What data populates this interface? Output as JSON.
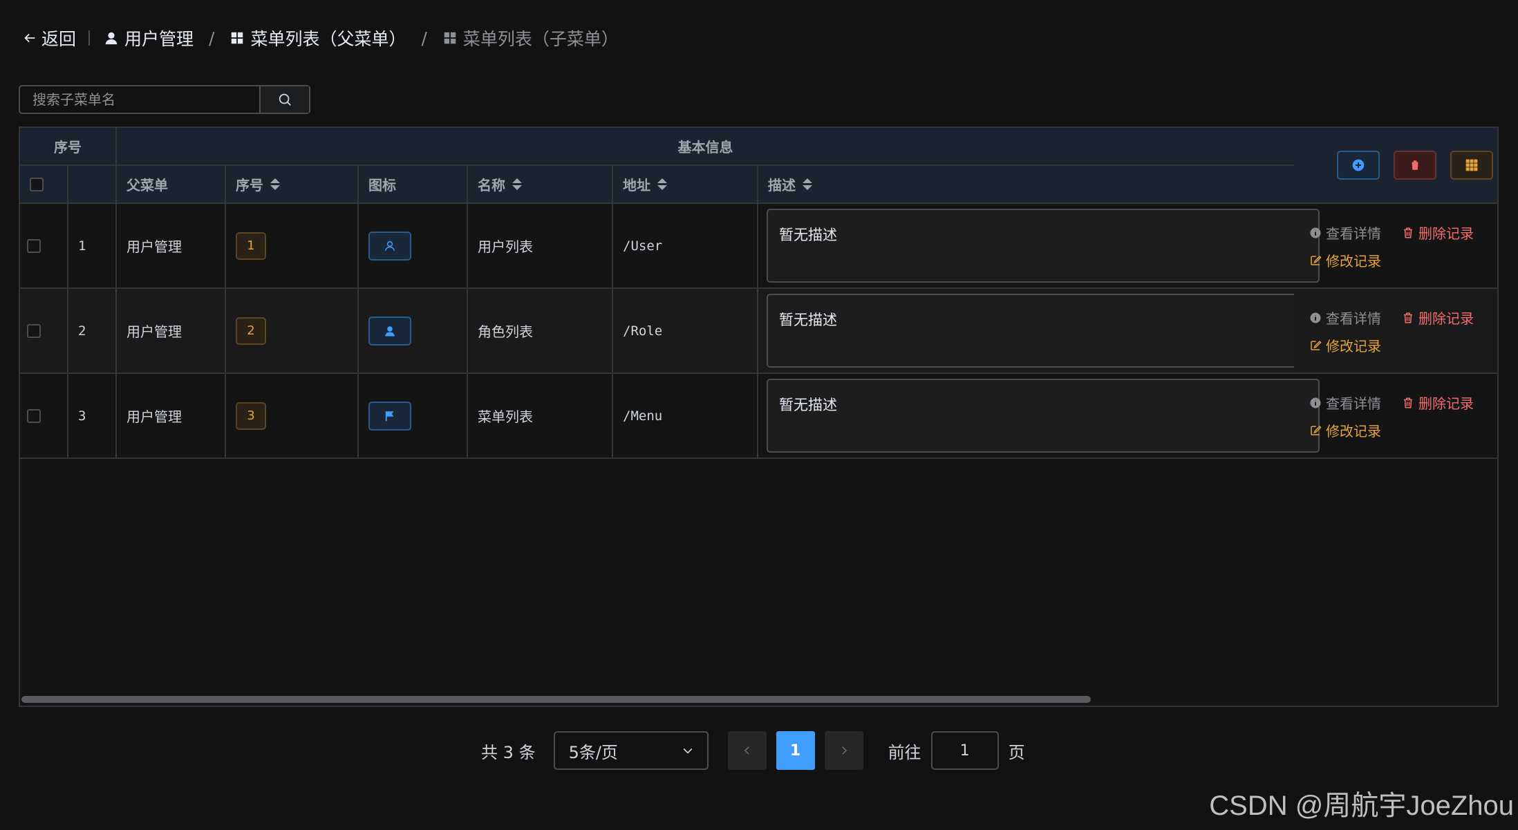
{
  "breadcrumb": {
    "back": "返回",
    "items": [
      {
        "label": "用户管理",
        "icon": "user-icon"
      },
      {
        "label": "菜单列表（父菜单）",
        "icon": "grid-icon"
      },
      {
        "label": "菜单列表（子菜单）",
        "icon": "grid-icon"
      }
    ],
    "separator": "/"
  },
  "search": {
    "placeholder": "搜索子菜单名"
  },
  "table": {
    "group_headers": {
      "index": "序号",
      "basic": "基本信息"
    },
    "columns": {
      "parent": "父菜单",
      "order": "序号",
      "icon": "图标",
      "name": "名称",
      "path": "地址",
      "desc": "描述"
    },
    "rows": [
      {
        "idx": "1",
        "parent": "用户管理",
        "order": "1",
        "icon": "user-outline-icon",
        "name": "用户列表",
        "path": "/User",
        "desc": "暂无描述"
      },
      {
        "idx": "2",
        "parent": "用户管理",
        "order": "2",
        "icon": "user-filled-icon",
        "name": "角色列表",
        "path": "/Role",
        "desc": "暂无描述"
      },
      {
        "idx": "3",
        "parent": "用户管理",
        "order": "3",
        "icon": "flag-icon",
        "name": "菜单列表",
        "path": "/Menu",
        "desc": "暂无描述"
      }
    ],
    "actions": {
      "view": "查看详情",
      "delete": "删除记录",
      "edit": "修改记录"
    },
    "toolbar": {
      "add": "plus-circle-icon",
      "delete": "trash-icon",
      "columns": "grid-icon"
    }
  },
  "pagination": {
    "total_prefix": "共",
    "total": "3",
    "total_suffix": "条",
    "page_size": "5条/页",
    "current": "1",
    "goto_prefix": "前往",
    "goto_value": "1",
    "goto_suffix": "页"
  },
  "watermark": "CSDN @周航宇JoeZhou",
  "colors": {
    "primary": "#409eff",
    "danger": "#f56c6c",
    "warning": "#e6a23c",
    "header_bg": "#1b2330"
  }
}
